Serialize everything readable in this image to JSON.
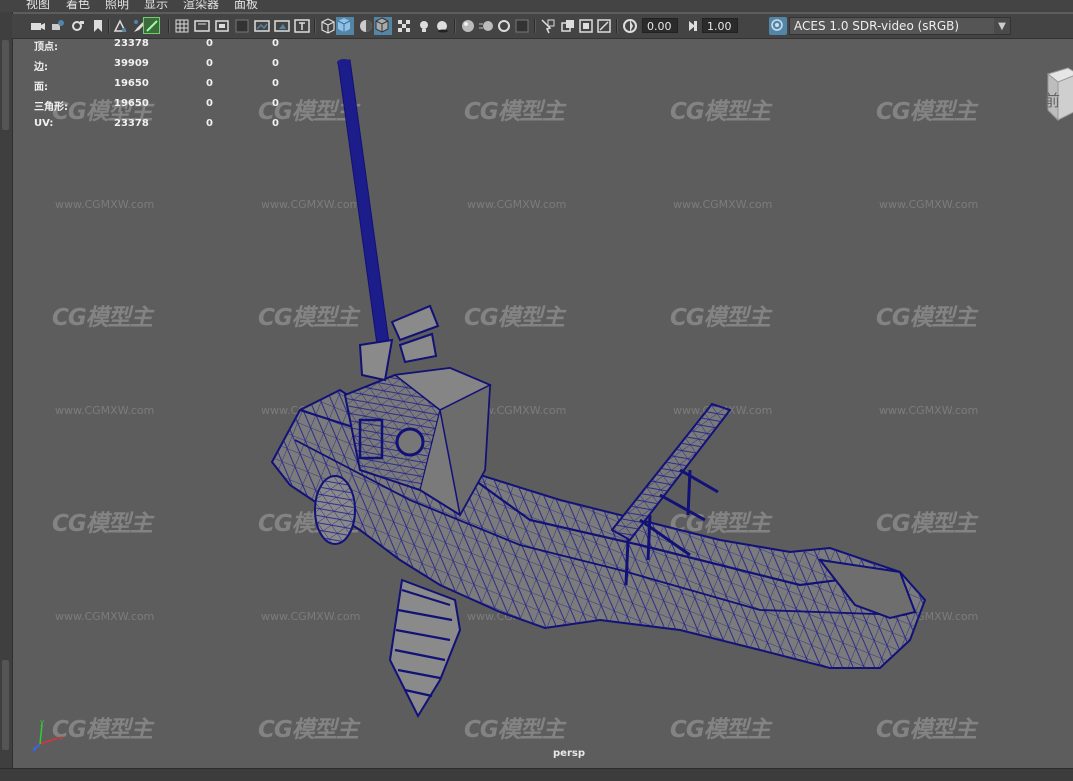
{
  "menu": {
    "items": [
      "视图",
      "着色",
      "照明",
      "显示",
      "渲染器",
      "面板"
    ]
  },
  "toolbar": {
    "exposure_value": "0.00",
    "gamma_value": "1.00",
    "color_management": "ACES 1.0 SDR-video (sRGB)",
    "icons": [
      "camera-select-icon",
      "camera-attributes-icon",
      "bookmark-icon",
      "image-plane-icon",
      "2d-pan-zoom-icon",
      "grease-pencil-icon",
      "grid-icon",
      "film-gate-icon",
      "resolution-gate-icon",
      "gate-mask-icon",
      "field-chart-icon",
      "safe-action-icon",
      "safe-title-icon",
      "wireframe-icon",
      "smooth-shade-icon",
      "use-default-material-icon",
      "wireframe-on-shaded-icon",
      "textured-icon",
      "use-all-lights-icon",
      "shadows-icon",
      "screen-space-ao-icon",
      "motion-blur-icon",
      "anti-aliasing-icon",
      "depth-of-field-icon",
      "isolate-select-icon",
      "xray-icon",
      "xray-active-components-icon",
      "xray-joints-icon",
      "exposure-icon",
      "gamma-icon",
      "color-management-icon"
    ],
    "accent_color": "#5285a6"
  },
  "hud": {
    "rows": [
      {
        "label": "顶点:",
        "c1": "23378",
        "c2": "0",
        "c3": "0"
      },
      {
        "label": "边:",
        "c1": "39909",
        "c2": "0",
        "c3": "0"
      },
      {
        "label": "面:",
        "c1": "19650",
        "c2": "0",
        "c3": "0"
      },
      {
        "label": "三角形:",
        "c1": "19650",
        "c2": "0",
        "c3": "0"
      },
      {
        "label": "UV:",
        "c1": "23378",
        "c2": "0",
        "c3": "0"
      }
    ]
  },
  "viewport": {
    "camera": "persp",
    "viewcube_label": "前",
    "wireframe_color": "#1a1a80",
    "background_color": "#5d5d5d"
  },
  "watermark": {
    "logo": "CG模型主",
    "url": "www.CGMXW.com"
  }
}
